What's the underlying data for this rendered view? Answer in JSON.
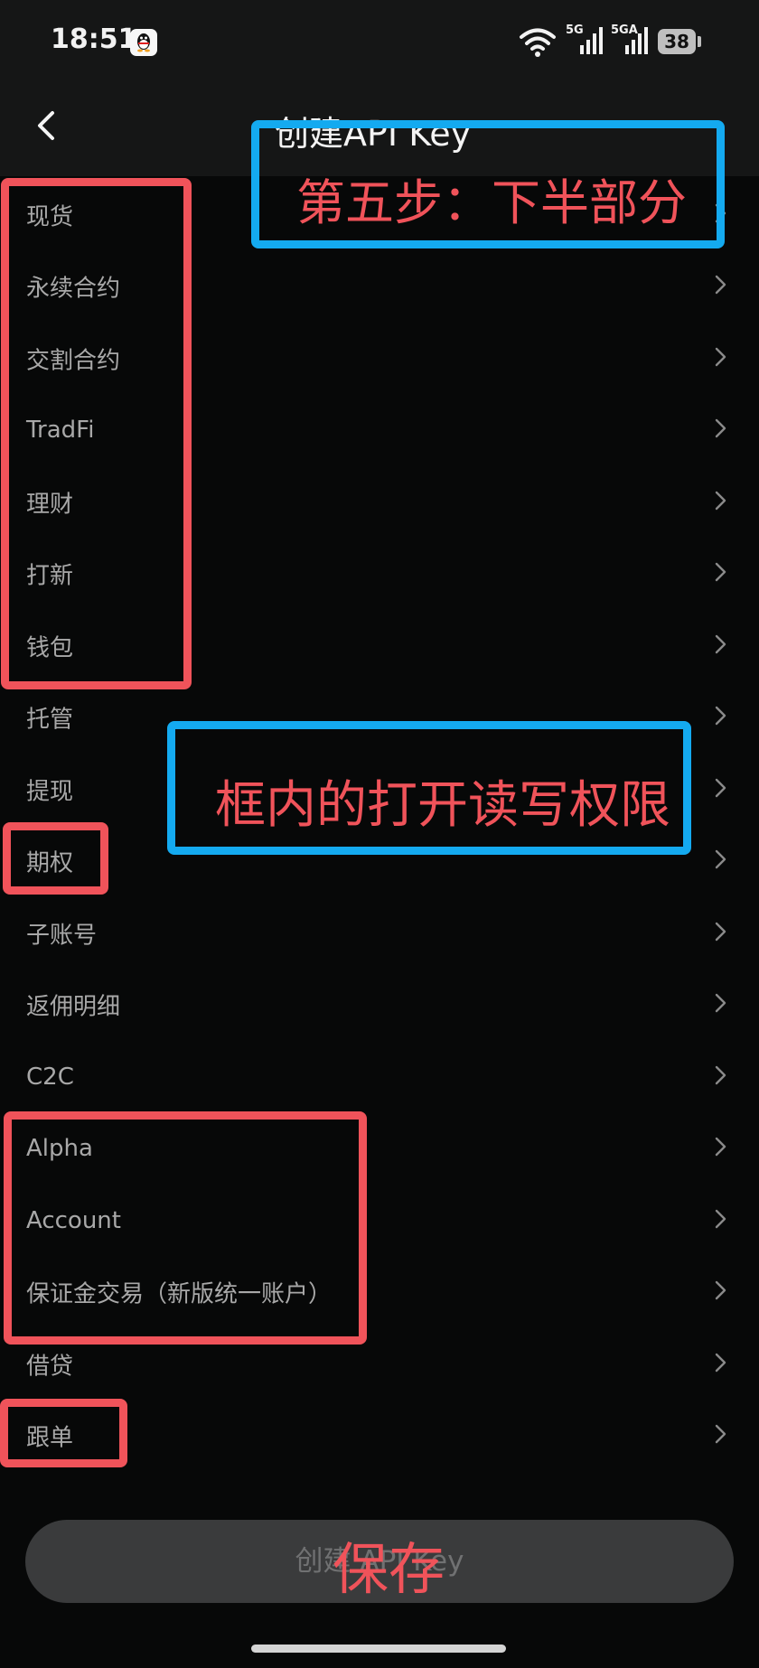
{
  "status_bar": {
    "time": "18:51",
    "app_icon": "qq-icon",
    "signal_1_label": "5G",
    "signal_2_label": "5GA",
    "battery": "38"
  },
  "header": {
    "back_icon": "chevron-left-icon",
    "title": "创建API Key"
  },
  "permission_rows": [
    {
      "label": "现货"
    },
    {
      "label": "永续合约"
    },
    {
      "label": "交割合约"
    },
    {
      "label": "TradFi"
    },
    {
      "label": "理财"
    },
    {
      "label": "打新"
    },
    {
      "label": "钱包"
    },
    {
      "label": "托管"
    },
    {
      "label": "提现"
    },
    {
      "label": "期权"
    },
    {
      "label": "子账号"
    },
    {
      "label": "返佣明细"
    },
    {
      "label": "C2C"
    },
    {
      "label": "Alpha"
    },
    {
      "label": "Account"
    },
    {
      "label": "保证金交易（新版统一账户）"
    },
    {
      "label": "借贷"
    },
    {
      "label": "跟单"
    }
  ],
  "row_icon": "chevron-right-icon",
  "create_button": {
    "label": "创建 API Key"
  },
  "annotations": {
    "step_label": "第五步：下半部分",
    "instruction": "框内的打开读写权限",
    "save_label": "保存",
    "red_color": "#f0535a",
    "blue_color": "#14aaf0"
  }
}
